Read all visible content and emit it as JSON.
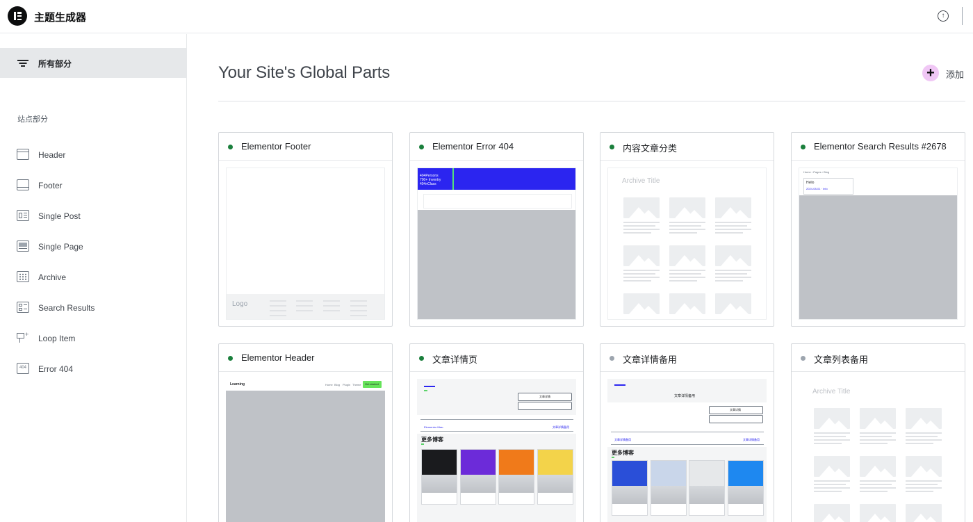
{
  "app": {
    "title": "主题生成器"
  },
  "colors": {
    "active_dot": "#1a7f3c",
    "inactive_dot": "#9da5ae",
    "add_button_bg": "#f0c7f5",
    "selected_nav_bg": "#e6e8ea"
  },
  "sidebar": {
    "all_parts_label": "所有部分",
    "section_title": "站点部分",
    "items": [
      {
        "label": "Header",
        "icon": "header-icon"
      },
      {
        "label": "Footer",
        "icon": "footer-icon"
      },
      {
        "label": "Single Post",
        "icon": "single-post-icon"
      },
      {
        "label": "Single Page",
        "icon": "single-page-icon"
      },
      {
        "label": "Archive",
        "icon": "archive-icon"
      },
      {
        "label": "Search Results",
        "icon": "search-results-icon"
      },
      {
        "label": "Loop Item",
        "icon": "loop-item-icon"
      },
      {
        "label": "Error 404",
        "icon": "error-404-icon"
      }
    ]
  },
  "main": {
    "title": "Your Site's Global Parts",
    "add_label": "添加",
    "cards": [
      {
        "title": "Elementor Footer",
        "status": "active",
        "preview": "footer",
        "logo_text": "Logo"
      },
      {
        "title": "Elementor Error 404",
        "status": "active",
        "preview": "error404",
        "code_lines": [
          "404Persons",
          "700+ Inventry",
          "404nClass"
        ]
      },
      {
        "title": "内容文章分类",
        "status": "active",
        "preview": "archive",
        "archive_title": "Archive Title"
      },
      {
        "title": "Elementor Search Results #2678",
        "status": "active",
        "preview": "search",
        "crumb": "Home › Pages › Blog",
        "crumb2": "Hello",
        "crumb3": "2024-08-01 · Info"
      },
      {
        "title": "Elementor Header",
        "status": "active",
        "preview": "header",
        "site_name": "Learning",
        "menu": [
          "Home",
          "Blog",
          "Plugin",
          "Theme"
        ],
        "cta": "Get started"
      },
      {
        "title": "文章详情页",
        "status": "active",
        "preview": "single",
        "more_blog": "更多博客",
        "prev_text": "Elementor Mas..",
        "next_text": "文章详情备用",
        "btn_text": "文章详情"
      },
      {
        "title": "文章详情备用",
        "status": "inactive",
        "preview": "single2",
        "more_blog": "更多博客",
        "banner_title": "文章详情备用",
        "prev_text": "文章详情备用",
        "next_text": "文章详情备用",
        "btn_text": "文章详情"
      },
      {
        "title": "文章列表备用",
        "status": "inactive",
        "preview": "archive",
        "archive_title": "Archive Title"
      }
    ]
  }
}
